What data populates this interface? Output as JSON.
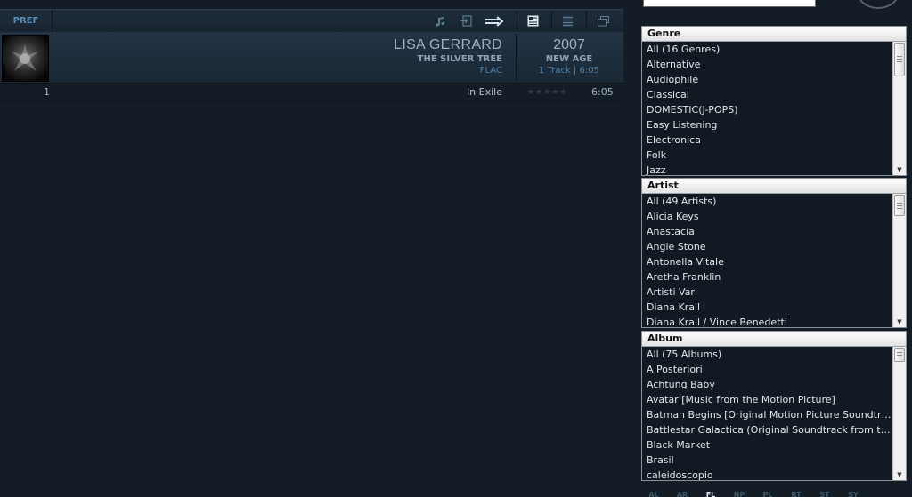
{
  "toolbar": {
    "pref_label": "PREF",
    "icons": [
      "music-note-icon",
      "import-icon",
      "shuffle-arrow-icon",
      "album-view-icon",
      "list-view-icon",
      "window-icon"
    ]
  },
  "album": {
    "artist": "LISA GERRARD",
    "title": "THE SILVER TREE",
    "format": "FLAC",
    "year": "2007",
    "genre": "NEW AGE",
    "track_info": "1 Track | 6:05"
  },
  "tracks": [
    {
      "number": "1",
      "title": "In Exile",
      "rating": "★★★★★",
      "time": "6:05"
    }
  ],
  "genre_panel": {
    "header": "Genre",
    "items": [
      "All (16 Genres)",
      "Alternative",
      "Audiophile",
      "Classical",
      "DOMESTIC(J-POPS)",
      "Easy Listening",
      "Electronica",
      "Folk",
      "Jazz"
    ]
  },
  "artist_panel": {
    "header": "Artist",
    "items": [
      "All (49 Artists)",
      "Alicia Keys",
      "Anastacia",
      "Angie Stone",
      "Antonella Vitale",
      "Aretha Franklin",
      "Artisti Vari",
      "Diana Krall",
      "Diana Krall / Vince Benedetti"
    ]
  },
  "album_panel": {
    "header": "Album",
    "items": [
      "All (75 Albums)",
      "A Posteriori",
      "Achtung Baby",
      "Avatar [Music from the Motion Picture]",
      "Batman Begins [Original Motion Picture Soundtrack]",
      "Battlestar Galactica (Original Soundtrack from the Sci Fi Channel Series)",
      "Black Market",
      "Brasil",
      "caleidoscopio"
    ]
  },
  "bottom_tabs": [
    "AL",
    "AR",
    "FL",
    "NP",
    "PL",
    "RT",
    "ST",
    "SY"
  ],
  "colors": {
    "background": "#141d26",
    "accent": "#4e7fa6",
    "panel_header": "#ffffff"
  }
}
